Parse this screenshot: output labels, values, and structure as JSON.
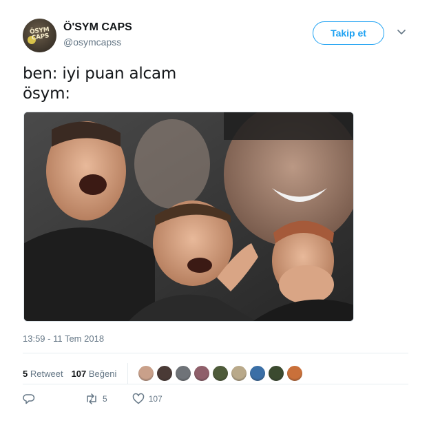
{
  "profile": {
    "name": "Ö'SYM CAPS",
    "handle": "@osymcapss",
    "avatar_text": "ÖSYM CAPS"
  },
  "follow_label": "Takip et",
  "tweet": {
    "text": "ben: iyi puan alcam\nösym:"
  },
  "timestamp": "13:59 - 11 Tem 2018",
  "stats": {
    "retweet_count": "5",
    "retweet_label": "Retweet",
    "like_count": "107",
    "like_label": "Beğeni"
  },
  "likers": [
    {
      "color": "#c9a08a"
    },
    {
      "color": "#4a3a36"
    },
    {
      "color": "#6f7378"
    },
    {
      "color": "#8f5f6a"
    },
    {
      "color": "#4e5b3a"
    },
    {
      "color": "#b9a98a"
    },
    {
      "color": "#3b6fa6"
    },
    {
      "color": "#3b4a2f"
    },
    {
      "color": "#c9703a"
    }
  ],
  "actions": {
    "reply_count": "",
    "retweet_count": "5",
    "like_count": "107"
  },
  "colors": {
    "accent": "#1da1f2",
    "secondary_text": "#657786",
    "primary_text": "#14171a"
  }
}
